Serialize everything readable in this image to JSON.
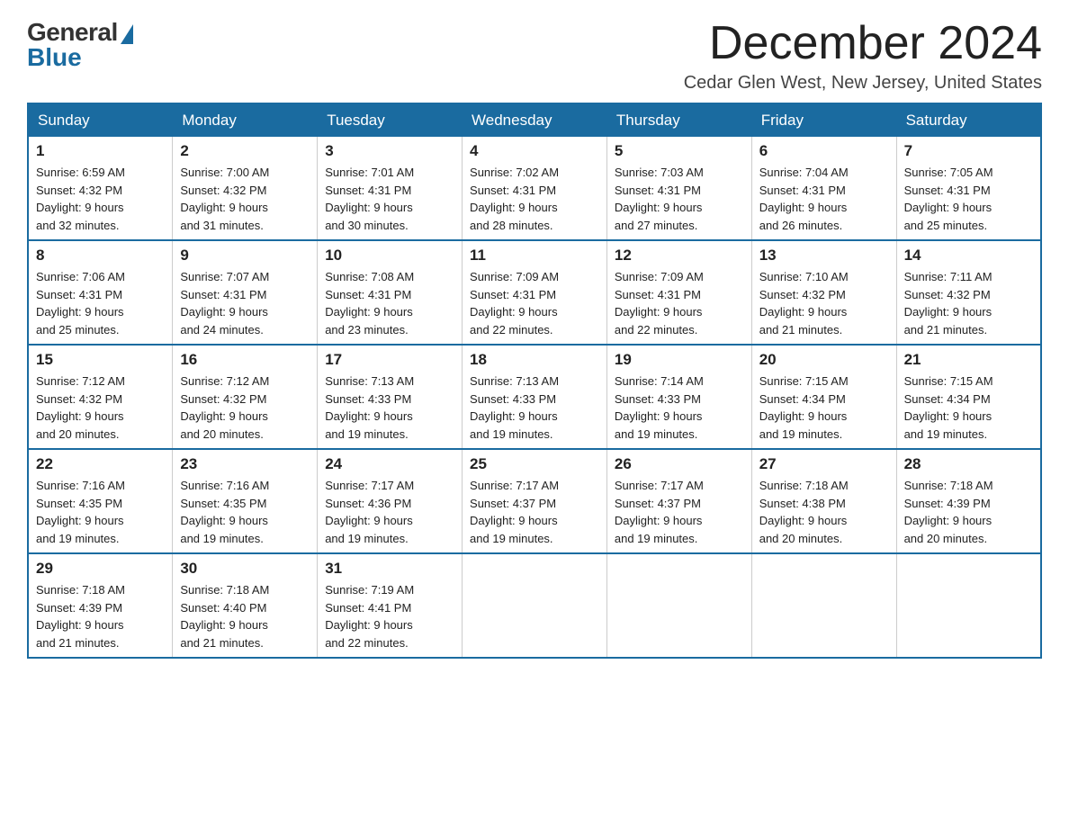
{
  "header": {
    "logo_general": "General",
    "logo_blue": "Blue",
    "month_title": "December 2024",
    "location": "Cedar Glen West, New Jersey, United States"
  },
  "calendar": {
    "days_of_week": [
      "Sunday",
      "Monday",
      "Tuesday",
      "Wednesday",
      "Thursday",
      "Friday",
      "Saturday"
    ],
    "weeks": [
      [
        {
          "day": "1",
          "sunrise": "Sunrise: 6:59 AM",
          "sunset": "Sunset: 4:32 PM",
          "daylight": "Daylight: 9 hours and 32 minutes."
        },
        {
          "day": "2",
          "sunrise": "Sunrise: 7:00 AM",
          "sunset": "Sunset: 4:32 PM",
          "daylight": "Daylight: 9 hours and 31 minutes."
        },
        {
          "day": "3",
          "sunrise": "Sunrise: 7:01 AM",
          "sunset": "Sunset: 4:31 PM",
          "daylight": "Daylight: 9 hours and 30 minutes."
        },
        {
          "day": "4",
          "sunrise": "Sunrise: 7:02 AM",
          "sunset": "Sunset: 4:31 PM",
          "daylight": "Daylight: 9 hours and 28 minutes."
        },
        {
          "day": "5",
          "sunrise": "Sunrise: 7:03 AM",
          "sunset": "Sunset: 4:31 PM",
          "daylight": "Daylight: 9 hours and 27 minutes."
        },
        {
          "day": "6",
          "sunrise": "Sunrise: 7:04 AM",
          "sunset": "Sunset: 4:31 PM",
          "daylight": "Daylight: 9 hours and 26 minutes."
        },
        {
          "day": "7",
          "sunrise": "Sunrise: 7:05 AM",
          "sunset": "Sunset: 4:31 PM",
          "daylight": "Daylight: 9 hours and 25 minutes."
        }
      ],
      [
        {
          "day": "8",
          "sunrise": "Sunrise: 7:06 AM",
          "sunset": "Sunset: 4:31 PM",
          "daylight": "Daylight: 9 hours and 25 minutes."
        },
        {
          "day": "9",
          "sunrise": "Sunrise: 7:07 AM",
          "sunset": "Sunset: 4:31 PM",
          "daylight": "Daylight: 9 hours and 24 minutes."
        },
        {
          "day": "10",
          "sunrise": "Sunrise: 7:08 AM",
          "sunset": "Sunset: 4:31 PM",
          "daylight": "Daylight: 9 hours and 23 minutes."
        },
        {
          "day": "11",
          "sunrise": "Sunrise: 7:09 AM",
          "sunset": "Sunset: 4:31 PM",
          "daylight": "Daylight: 9 hours and 22 minutes."
        },
        {
          "day": "12",
          "sunrise": "Sunrise: 7:09 AM",
          "sunset": "Sunset: 4:31 PM",
          "daylight": "Daylight: 9 hours and 22 minutes."
        },
        {
          "day": "13",
          "sunrise": "Sunrise: 7:10 AM",
          "sunset": "Sunset: 4:32 PM",
          "daylight": "Daylight: 9 hours and 21 minutes."
        },
        {
          "day": "14",
          "sunrise": "Sunrise: 7:11 AM",
          "sunset": "Sunset: 4:32 PM",
          "daylight": "Daylight: 9 hours and 21 minutes."
        }
      ],
      [
        {
          "day": "15",
          "sunrise": "Sunrise: 7:12 AM",
          "sunset": "Sunset: 4:32 PM",
          "daylight": "Daylight: 9 hours and 20 minutes."
        },
        {
          "day": "16",
          "sunrise": "Sunrise: 7:12 AM",
          "sunset": "Sunset: 4:32 PM",
          "daylight": "Daylight: 9 hours and 20 minutes."
        },
        {
          "day": "17",
          "sunrise": "Sunrise: 7:13 AM",
          "sunset": "Sunset: 4:33 PM",
          "daylight": "Daylight: 9 hours and 19 minutes."
        },
        {
          "day": "18",
          "sunrise": "Sunrise: 7:13 AM",
          "sunset": "Sunset: 4:33 PM",
          "daylight": "Daylight: 9 hours and 19 minutes."
        },
        {
          "day": "19",
          "sunrise": "Sunrise: 7:14 AM",
          "sunset": "Sunset: 4:33 PM",
          "daylight": "Daylight: 9 hours and 19 minutes."
        },
        {
          "day": "20",
          "sunrise": "Sunrise: 7:15 AM",
          "sunset": "Sunset: 4:34 PM",
          "daylight": "Daylight: 9 hours and 19 minutes."
        },
        {
          "day": "21",
          "sunrise": "Sunrise: 7:15 AM",
          "sunset": "Sunset: 4:34 PM",
          "daylight": "Daylight: 9 hours and 19 minutes."
        }
      ],
      [
        {
          "day": "22",
          "sunrise": "Sunrise: 7:16 AM",
          "sunset": "Sunset: 4:35 PM",
          "daylight": "Daylight: 9 hours and 19 minutes."
        },
        {
          "day": "23",
          "sunrise": "Sunrise: 7:16 AM",
          "sunset": "Sunset: 4:35 PM",
          "daylight": "Daylight: 9 hours and 19 minutes."
        },
        {
          "day": "24",
          "sunrise": "Sunrise: 7:17 AM",
          "sunset": "Sunset: 4:36 PM",
          "daylight": "Daylight: 9 hours and 19 minutes."
        },
        {
          "day": "25",
          "sunrise": "Sunrise: 7:17 AM",
          "sunset": "Sunset: 4:37 PM",
          "daylight": "Daylight: 9 hours and 19 minutes."
        },
        {
          "day": "26",
          "sunrise": "Sunrise: 7:17 AM",
          "sunset": "Sunset: 4:37 PM",
          "daylight": "Daylight: 9 hours and 19 minutes."
        },
        {
          "day": "27",
          "sunrise": "Sunrise: 7:18 AM",
          "sunset": "Sunset: 4:38 PM",
          "daylight": "Daylight: 9 hours and 20 minutes."
        },
        {
          "day": "28",
          "sunrise": "Sunrise: 7:18 AM",
          "sunset": "Sunset: 4:39 PM",
          "daylight": "Daylight: 9 hours and 20 minutes."
        }
      ],
      [
        {
          "day": "29",
          "sunrise": "Sunrise: 7:18 AM",
          "sunset": "Sunset: 4:39 PM",
          "daylight": "Daylight: 9 hours and 21 minutes."
        },
        {
          "day": "30",
          "sunrise": "Sunrise: 7:18 AM",
          "sunset": "Sunset: 4:40 PM",
          "daylight": "Daylight: 9 hours and 21 minutes."
        },
        {
          "day": "31",
          "sunrise": "Sunrise: 7:19 AM",
          "sunset": "Sunset: 4:41 PM",
          "daylight": "Daylight: 9 hours and 22 minutes."
        },
        null,
        null,
        null,
        null
      ]
    ]
  }
}
